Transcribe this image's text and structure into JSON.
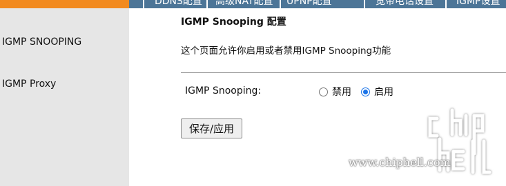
{
  "top_nav": {
    "items": [
      "DDNS配置",
      "高级NAT配置",
      "UPNP配置",
      "宽带电话设置",
      "IGMP设置"
    ]
  },
  "sidebar": {
    "items": [
      {
        "label": "IGMP SNOOPING"
      },
      {
        "label": "IGMP Proxy"
      }
    ]
  },
  "main": {
    "title": "IGMP Snooping 配置",
    "description": "这个页面允许你启用或者禁用IGMP Snooping功能",
    "field_label": "IGMP Snooping:",
    "options": [
      {
        "label": "禁用",
        "checked": false
      },
      {
        "label": "启用",
        "checked": true
      }
    ],
    "save_label": "保存/应用"
  },
  "watermark": {
    "text": "www.chiphell.com"
  },
  "colors": {
    "topbar_orange": "#f28a1e",
    "topbar_blue": "#4c7597",
    "sidebar_bg": "#e6e6e6",
    "radio_accent": "#1a73e8"
  }
}
